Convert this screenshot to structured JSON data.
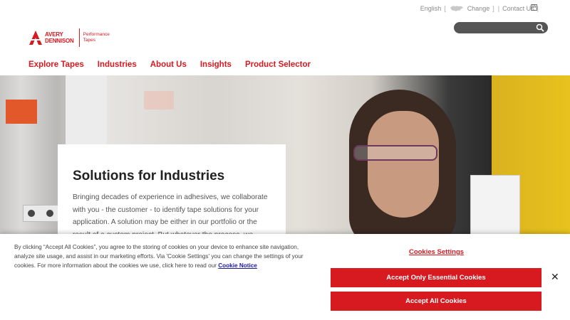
{
  "utility": {
    "language": "English",
    "change_label": "Change",
    "contact_label": "Contact Us",
    "linkedin_label": "in"
  },
  "logo": {
    "line1": "AVERY",
    "line2": "DENNISON",
    "sub1": "Performance",
    "sub2": "Tapes"
  },
  "search": {
    "placeholder": ""
  },
  "nav": {
    "items": [
      {
        "label": "Explore Tapes"
      },
      {
        "label": "Industries"
      },
      {
        "label": "About Us"
      },
      {
        "label": "Insights"
      },
      {
        "label": "Product Selector"
      }
    ]
  },
  "hero": {
    "title": "Solutions for Industries",
    "body": "Bringing decades of experience in adhesives, we collaborate with you - the customer - to identify tape solutions for your application. A solution may be either in our portfolio or the result of a custom project. But whatever the process, we"
  },
  "cookie": {
    "text": "By clicking “Accept All Cookies”, you agree to the storing of cookies on your device to enhance site navigation, analyze site usage, and assist in our marketing efforts. Via 'Cookie Settings' you can change the settings of your cookies. For more information about the cookies we use, click here to read our",
    "notice_link": "Cookie Notice",
    "settings_label": "Cookies Settings",
    "essential_label": "Accept Only Essential Cookies",
    "accept_all_label": "Accept All Cookies",
    "close_label": "✕"
  },
  "colors": {
    "brand_red": "#d71920",
    "search_bg": "#555555"
  },
  "icons": {
    "globe": "globe-icon",
    "search": "search-icon",
    "linkedin": "linkedin-icon",
    "close": "close-icon"
  }
}
